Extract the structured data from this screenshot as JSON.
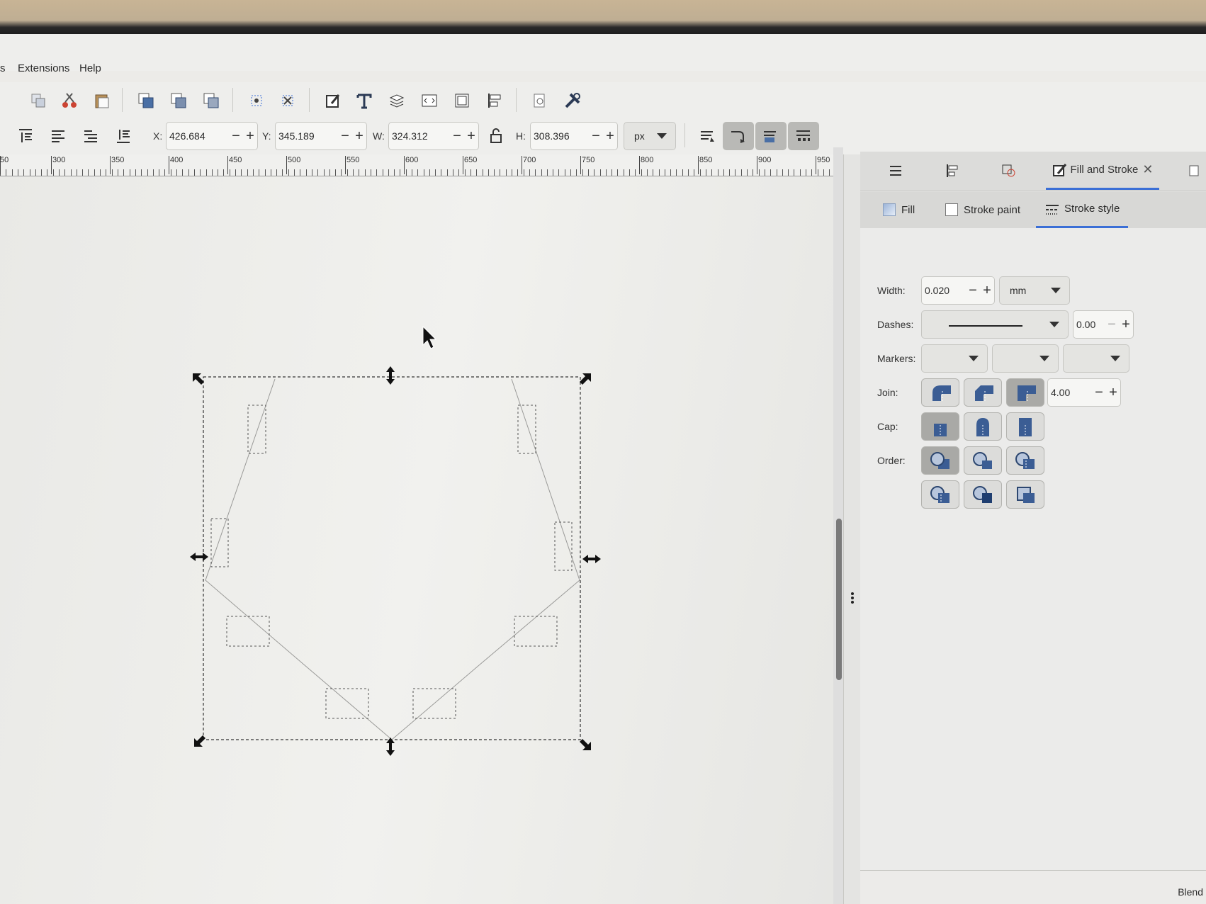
{
  "menu": {
    "items": [
      "s",
      "Extensions",
      "Help"
    ]
  },
  "toolbar": {
    "icons": [
      "duplicate-icon",
      "cut-icon",
      "paste-icon",
      "group-icon",
      "clone-icon",
      "unlink-icon",
      "select-same-icon",
      "deselect-icon",
      "fill-stroke-icon",
      "text-icon",
      "layers-icon",
      "xml-editor-icon",
      "document-properties-icon",
      "align-distribute-icon",
      "print-preview-icon",
      "preferences-icon"
    ]
  },
  "controls": {
    "x_label": "X:",
    "x_value": "426.684",
    "y_label": "Y:",
    "y_value": "345.189",
    "w_label": "W:",
    "w_value": "324.312",
    "h_label": "H:",
    "h_value": "308.396",
    "unit": "px",
    "minus": "−",
    "plus": "+"
  },
  "ruler": {
    "labels": [
      "50",
      "300",
      "350",
      "400",
      "450",
      "500",
      "550",
      "600",
      "650",
      "700",
      "750",
      "800",
      "850",
      "900",
      "950"
    ]
  },
  "dock": {
    "active_tab": "Fill and Stroke",
    "sub_tabs": {
      "fill": "Fill",
      "stroke_paint": "Stroke paint",
      "stroke_style": "Stroke style"
    },
    "width_label": "Width:",
    "width_value": "0.020",
    "width_unit": "mm",
    "dashes_label": "Dashes:",
    "dash_offset": "0.00",
    "markers_label": "Markers:",
    "join_label": "Join:",
    "miter_limit": "4.00",
    "cap_label": "Cap:",
    "order_label": "Order:"
  },
  "status": {
    "blend": "Blend"
  }
}
